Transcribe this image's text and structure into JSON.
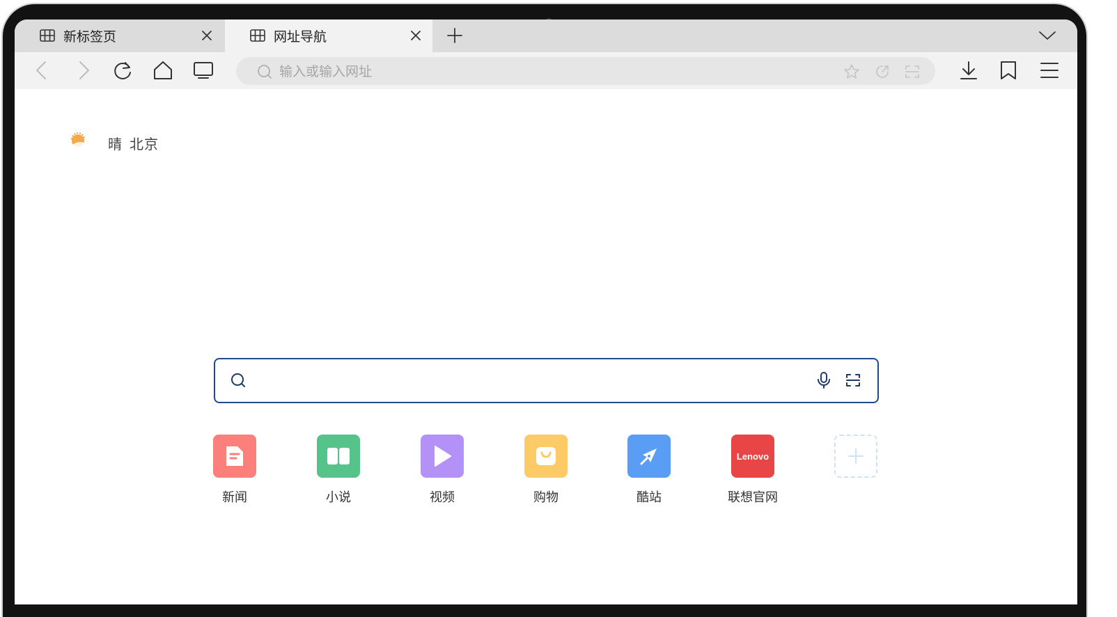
{
  "tabs": [
    {
      "title": "新标签页",
      "icon": "grid-icon",
      "active": false
    },
    {
      "title": "网址导航",
      "icon": "grid-icon",
      "active": true
    }
  ],
  "toolbar": {
    "address_placeholder": "输入或输入网址",
    "address_value": ""
  },
  "weather": {
    "condition": "晴",
    "city": "北京",
    "icon": "sunny-cloud-icon"
  },
  "search": {
    "placeholder": "",
    "value": ""
  },
  "shortcuts": [
    {
      "label": "新闻",
      "color": "#fb7f7a",
      "icon": "document-icon"
    },
    {
      "label": "小说",
      "color": "#55c38a",
      "icon": "book-icon"
    },
    {
      "label": "视频",
      "color": "#b391f7",
      "icon": "play-icon"
    },
    {
      "label": "购物",
      "color": "#fdca68",
      "icon": "shopping-bag-icon"
    },
    {
      "label": "酷站",
      "color": "#5a9df4",
      "icon": "compass-icon"
    },
    {
      "label": "联想官网",
      "color": "#e84646",
      "icon": "lenovo-logo",
      "logo_text": "Lenovo"
    },
    {
      "label": "",
      "color": "#cfe2f5",
      "icon": "plus-icon"
    }
  ],
  "colors": {
    "search_border": "#1f4a8a",
    "tabbar_bg": "#dcdcdc",
    "toolbar_bg": "#f2f2f2"
  }
}
